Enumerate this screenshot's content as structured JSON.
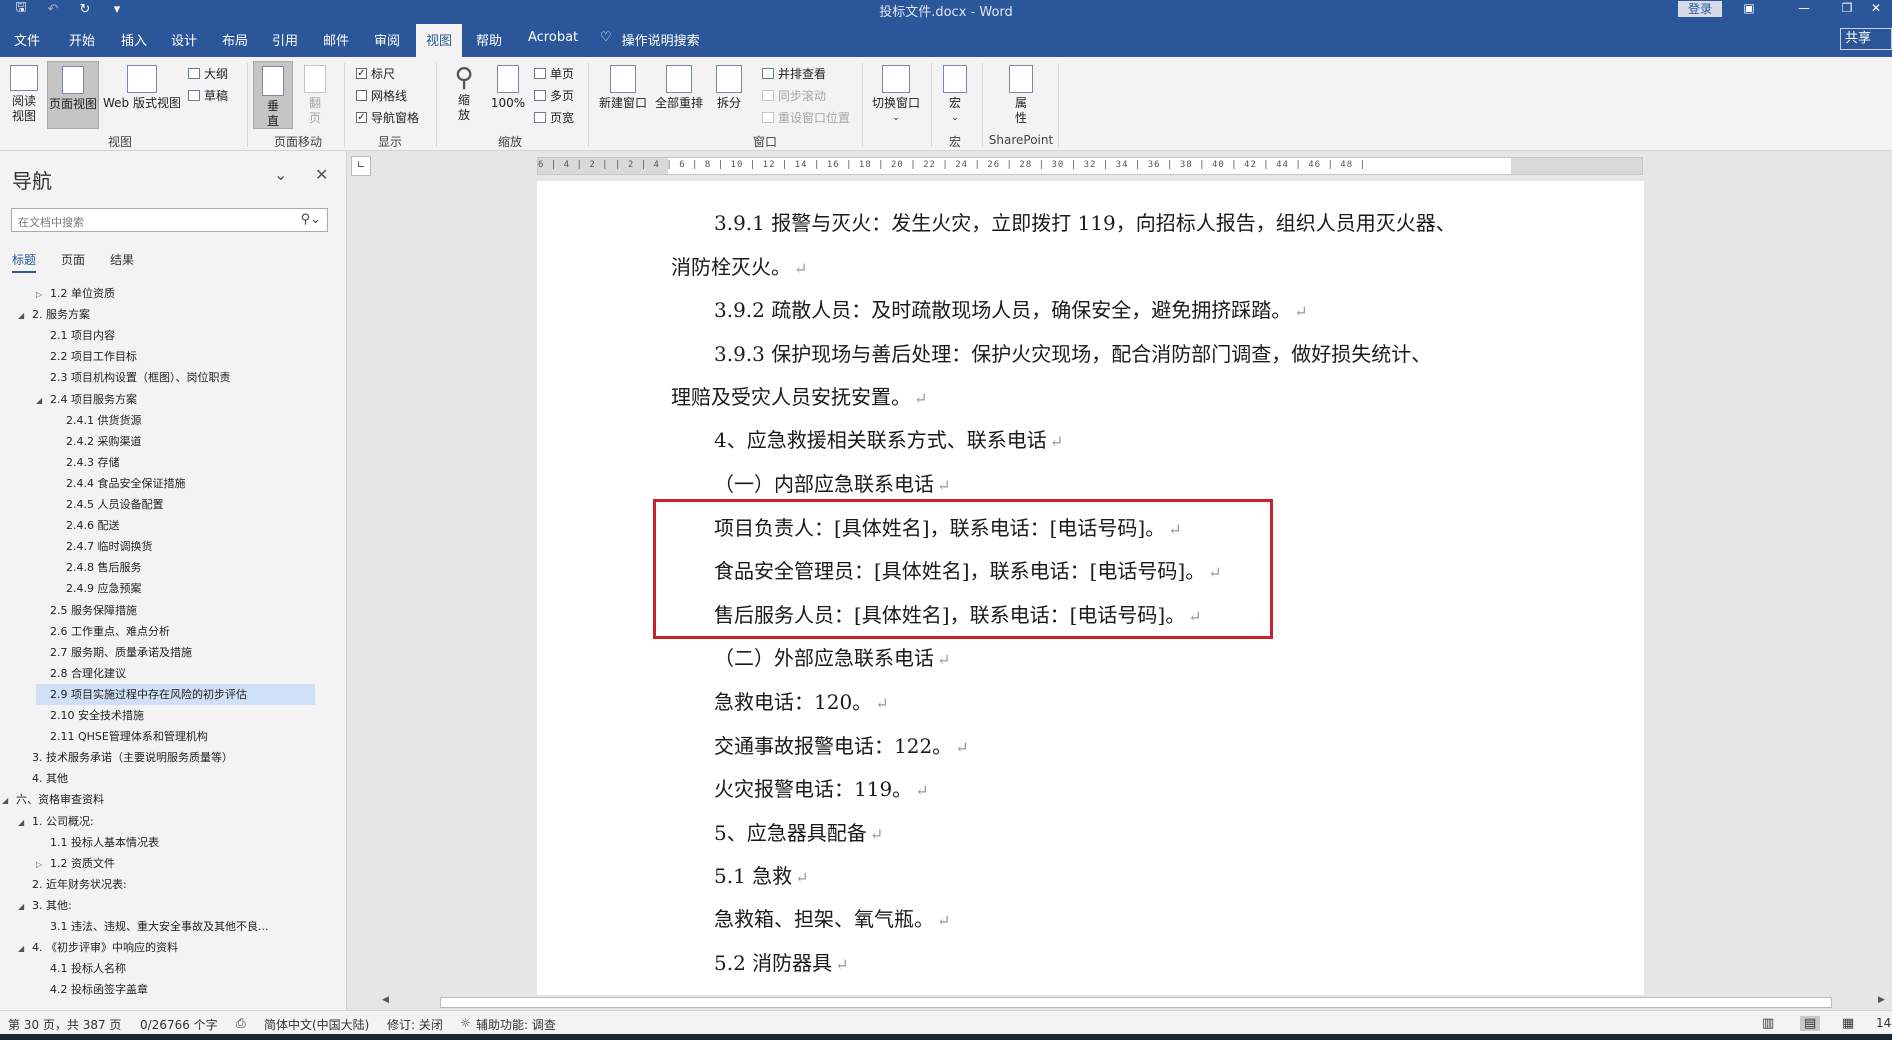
{
  "titlebar": {
    "title": "投标文件.docx - Word",
    "login_label": "登录",
    "qat_save": "🖫",
    "qat_undo": "↶",
    "qat_redo": "↻",
    "qat_customize": "▾",
    "ctrl_ribbon": "▣",
    "ctrl_min": "—",
    "ctrl_max": "❐",
    "ctrl_close": "✕"
  },
  "menu": {
    "tabs": [
      "文件",
      "开始",
      "插入",
      "设计",
      "布局",
      "引用",
      "邮件",
      "审阅",
      "视图",
      "帮助",
      "Acrobat"
    ],
    "active_tab": "视图",
    "tell_me_icon": "♡",
    "tell_me": "操作说明搜索",
    "share_label": "共享"
  },
  "ribbon": {
    "views": {
      "read_mode": "阅读视图",
      "print_layout": "页面视图",
      "web_layout": "Web 版式视图",
      "outline": "大纲",
      "draft": "草稿",
      "label": "视图"
    },
    "page_movement": {
      "vertical": "垂直",
      "side_by_side": "翻页",
      "label": "页面移动"
    },
    "show": {
      "ruler": "标尺",
      "gridlines": "网格线",
      "nav_pane": "导航窗格",
      "label": "显示",
      "ruler_checked": true,
      "gridlines_checked": false,
      "nav_pane_checked": true
    },
    "zoom": {
      "zoom": "缩放",
      "hundred": "100%",
      "one_page": "单页",
      "multi_page": "多页",
      "page_width": "页宽",
      "label": "缩放"
    },
    "window": {
      "new_window": "新建窗口",
      "arrange_all": "全部重排",
      "split": "拆分",
      "side_by_side": "并排查看",
      "sync_scroll": "同步滚动",
      "reset_pos": "重设窗口位置",
      "switch_windows": "切换窗口",
      "label": "窗口"
    },
    "macros": {
      "macros": "宏",
      "label": "宏"
    },
    "sharepoint": {
      "properties": "属性",
      "label": "SharePoint"
    }
  },
  "nav": {
    "title": "导航",
    "search_placeholder": "在文档中搜索",
    "tabs": [
      "标题",
      "页面",
      "结果"
    ],
    "items": [
      {
        "text": "1.2  单位资质",
        "level": 3,
        "arrow": "▷"
      },
      {
        "text": "2. 服务方案",
        "level": 2,
        "arrow": "◢"
      },
      {
        "text": "2.1  项目内容",
        "level": 3,
        "arrow": ""
      },
      {
        "text": "2.2  项目工作目标",
        "level": 3,
        "arrow": ""
      },
      {
        "text": "2.3  项目机构设置（框图）、岗位职责",
        "level": 3,
        "arrow": ""
      },
      {
        "text": "2.4  项目服务方案",
        "level": 3,
        "arrow": "◢"
      },
      {
        "text": "2.4.1  供货货源",
        "level": 4,
        "arrow": ""
      },
      {
        "text": "2.4.2  采购渠道",
        "level": 4,
        "arrow": ""
      },
      {
        "text": "2.4.3  存储",
        "level": 4,
        "arrow": ""
      },
      {
        "text": "2.4.4  食品安全保证措施",
        "level": 4,
        "arrow": ""
      },
      {
        "text": "2.4.5  人员设备配置",
        "level": 4,
        "arrow": ""
      },
      {
        "text": "2.4.6  配送",
        "level": 4,
        "arrow": ""
      },
      {
        "text": "2.4.7  临时调换货",
        "level": 4,
        "arrow": ""
      },
      {
        "text": "2.4.8  售后服务",
        "level": 4,
        "arrow": ""
      },
      {
        "text": "2.4.9  应急预案",
        "level": 4,
        "arrow": ""
      },
      {
        "text": "2.5  服务保障措施",
        "level": 3,
        "arrow": ""
      },
      {
        "text": "2.6  工作重点、难点分析",
        "level": 3,
        "arrow": ""
      },
      {
        "text": "2.7  服务期、质量承诺及措施",
        "level": 3,
        "arrow": ""
      },
      {
        "text": "2.8  合理化建议",
        "level": 3,
        "arrow": ""
      },
      {
        "text": "2.9  项目实施过程中存在风险的初步评估",
        "level": 3,
        "arrow": "",
        "selected": true
      },
      {
        "text": "2.10  安全技术措施",
        "level": 3,
        "arrow": ""
      },
      {
        "text": "2.11  QHSE管理体系和管理机构",
        "level": 3,
        "arrow": ""
      },
      {
        "text": "3. 技术服务承诺（主要说明服务质量等）",
        "level": 2,
        "arrow": ""
      },
      {
        "text": "4. 其他",
        "level": 2,
        "arrow": ""
      },
      {
        "text": "六、资格审查资料",
        "level": 1,
        "arrow": "◢"
      },
      {
        "text": "1. 公司概况:",
        "level": 2,
        "arrow": "◢"
      },
      {
        "text": "1.1  投标人基本情况表",
        "level": 3,
        "arrow": ""
      },
      {
        "text": "1.2  资质文件",
        "level": 3,
        "arrow": "▷"
      },
      {
        "text": "2. 近年财务状况表:",
        "level": 2,
        "arrow": ""
      },
      {
        "text": "3. 其他:",
        "level": 2,
        "arrow": "◢"
      },
      {
        "text": "3.1  违法、违规、重大安全事故及其他不良...",
        "level": 3,
        "arrow": ""
      },
      {
        "text": "4. 《初步评审》中响应的资料",
        "level": 2,
        "arrow": "◢"
      },
      {
        "text": "4.1  投标人名称",
        "level": 3,
        "arrow": ""
      },
      {
        "text": "4.2  投标函签字盖章",
        "level": 3,
        "arrow": ""
      }
    ]
  },
  "ruler": {
    "corner": "∟",
    "numbers": "6 | 4 | 2 |   | 2 | 4 | 6 | 8 | 10 | 12 | 14 | 16 | 18 | 20 | 22 | 24 | 26 | 28 | 30 | 32 | 34 | 36 | 38 | 40 | 42 | 44 | 46 | 48 |"
  },
  "document": {
    "paragraph_mark": "↵",
    "lines": [
      {
        "text": "3.9.1 报警与灭火：发生火灾，立即拨打 119，向招标人报告，组织人员用灭火器、",
        "indent": true,
        "mark": false
      },
      {
        "text": "消防栓灭火。",
        "indent": false,
        "mark": true
      },
      {
        "text": "3.9.2 疏散人员：及时疏散现场人员，确保安全，避免拥挤踩踏。",
        "indent": true,
        "mark": true
      },
      {
        "text": "3.9.3  保护现场与善后处理：保护火灾现场，配合消防部门调查，做好损失统计、",
        "indent": true,
        "mark": false
      },
      {
        "text": "理赔及受灾人员安抚安置。",
        "indent": false,
        "mark": true
      },
      {
        "text": "4、应急救援相关联系方式、联系电话",
        "indent": true,
        "mark": true
      },
      {
        "text": "（一）内部应急联系电话",
        "indent": true,
        "mark": true
      },
      {
        "text": "项目负责人：[具体姓名]，联系电话：[电话号码]。",
        "indent": true,
        "mark": true
      },
      {
        "text": "食品安全管理员：[具体姓名]，联系电话：[电话号码]。",
        "indent": true,
        "mark": true
      },
      {
        "text": "售后服务人员：[具体姓名]，联系电话：[电话号码]。",
        "indent": true,
        "mark": true
      },
      {
        "text": "（二）外部应急联系电话",
        "indent": true,
        "mark": true
      },
      {
        "text": "急救电话：120。",
        "indent": true,
        "mark": true
      },
      {
        "text": "交通事故报警电话：122。",
        "indent": true,
        "mark": true
      },
      {
        "text": "火灾报警电话：119。",
        "indent": true,
        "mark": true
      },
      {
        "text": "5、应急器具配备",
        "indent": true,
        "mark": true
      },
      {
        "text": "5.1 急救",
        "indent": true,
        "mark": true
      },
      {
        "text": "急救箱、担架、氧气瓶。",
        "indent": true,
        "mark": true
      },
      {
        "text": "5.2 消防器具",
        "indent": true,
        "mark": true
      }
    ]
  },
  "statusbar": {
    "page": "第 30 页，共 387 页",
    "words": "0/26766 个字",
    "lang_icon": "⎙",
    "language": "简体中文(中国大陆)",
    "track": "修订: 关闭",
    "a11y_icon": "☼",
    "accessibility": "辅助功能: 调查",
    "zoom_fragment": "14"
  },
  "colors": {
    "accent": "#2b579a",
    "highlight_border": "#c6232e",
    "nav_selected": "#cfe0f7"
  }
}
